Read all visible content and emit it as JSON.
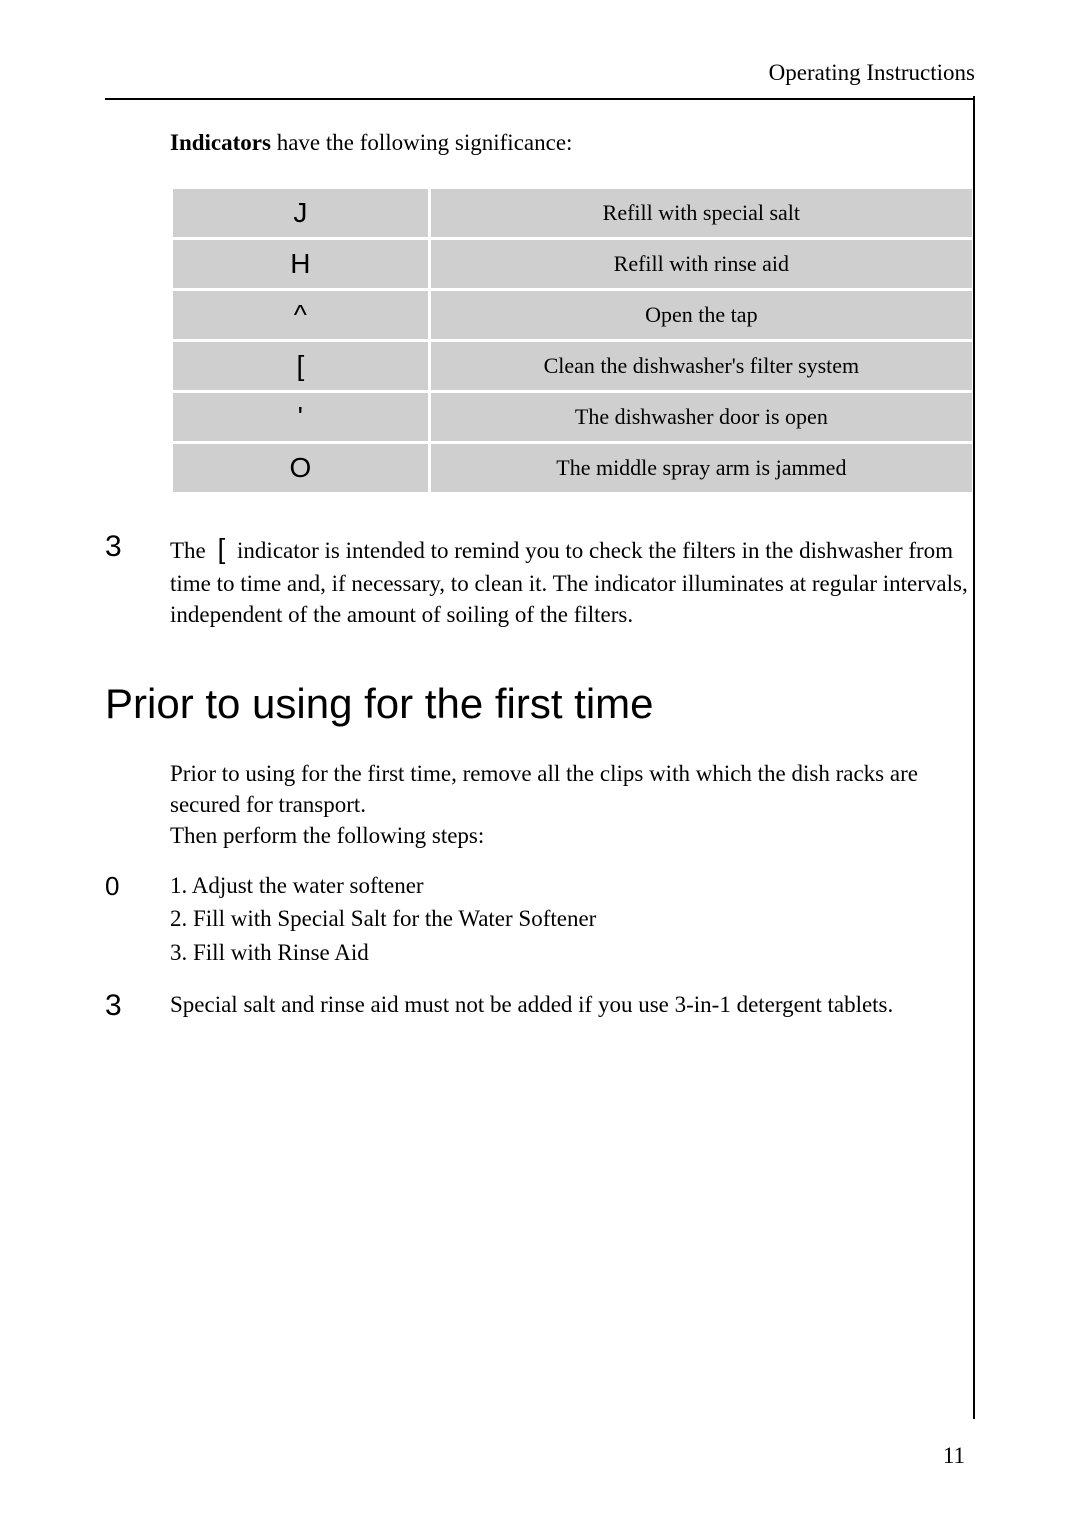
{
  "header": {
    "section_title": "Operating Instructions"
  },
  "indicators_intro": {
    "label": "Indicators",
    "rest": " have the following significance:"
  },
  "indicator_table": [
    {
      "symbol": "J",
      "meaning": "Refill with special salt"
    },
    {
      "symbol": "H",
      "meaning": "Refill with rinse aid"
    },
    {
      "symbol": "^",
      "meaning": "Open the tap"
    },
    {
      "symbol": "[",
      "meaning": "Clean the dishwasher's filter system"
    },
    {
      "symbol": "'",
      "meaning": "The dishwasher door is open"
    },
    {
      "symbol": "O",
      "meaning": "The middle spray arm is jammed"
    }
  ],
  "filter_note": {
    "marker": "3",
    "pre": "The ",
    "sym": "[",
    "post": " indicator is intended to remind you to check the filters in the dishwasher from time to time and, if necessary, to clean it. The indicator illuminates at regular intervals, independent of the amount of soiling of the filters."
  },
  "heading": "Prior to using for the first time",
  "first_use_intro": "Prior to using for the first time, remove all the clips with which the dish racks are secured for transport.\nThen perform the following steps:",
  "steps": {
    "marker": "0",
    "items": [
      "1. Adjust the water softener",
      "2. Fill with Special Salt for the Water Softener",
      "3. Fill with Rinse Aid"
    ]
  },
  "tablet_note": {
    "marker": "3",
    "text": "Special salt and rinse aid must not be added if you use 3-in-1 detergent tablets."
  },
  "page_number": "11"
}
